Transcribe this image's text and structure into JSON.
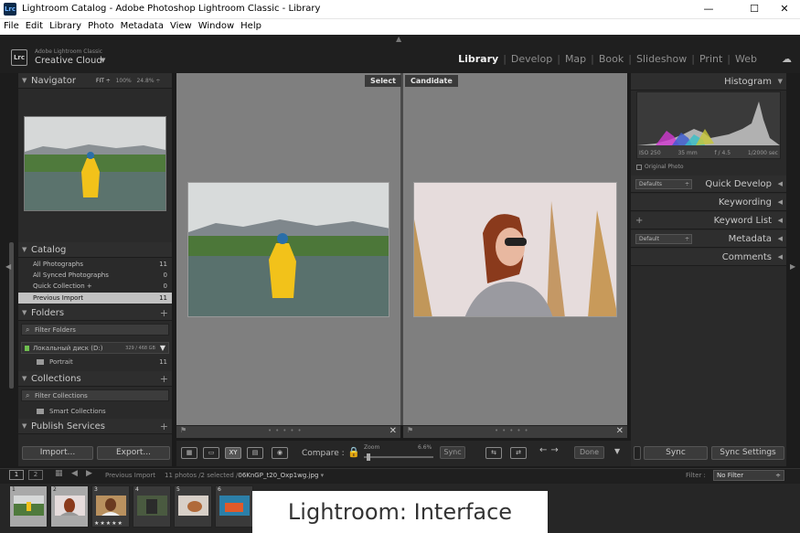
{
  "window": {
    "title": "Lightroom Catalog - Adobe Photoshop Lightroom Classic - Library",
    "app_badge": "Lrc",
    "minimize": "—",
    "maximize": "☐",
    "close": "✕"
  },
  "menu": [
    "File",
    "Edit",
    "Library",
    "Photo",
    "Metadata",
    "View",
    "Window",
    "Help"
  ],
  "identity": {
    "logo": "Lrc",
    "line1": "Adobe Lightroom Classic",
    "line2": "Creative Cloud"
  },
  "modules": [
    "Library",
    "Develop",
    "Map",
    "Book",
    "Slideshow",
    "Print",
    "Web"
  ],
  "active_module": "Library",
  "left_panel": {
    "navigator": {
      "title": "Navigator",
      "fit": "FIT ÷",
      "zoom1": "100%",
      "zoom2": "24.8% ÷"
    },
    "catalog": {
      "title": "Catalog",
      "items": [
        {
          "label": "All Photographs",
          "count": "11"
        },
        {
          "label": "All Synced Photographs",
          "count": "0"
        },
        {
          "label": "Quick Collection +",
          "count": "0"
        },
        {
          "label": "Previous Import",
          "count": "11"
        }
      ]
    },
    "folders": {
      "title": "Folders",
      "filter": "Filter Folders",
      "volume": "Локальный диск (D:)",
      "volume_size": "329 / 468 GB",
      "folder": {
        "label": "Portrait",
        "count": "11"
      }
    },
    "collections": {
      "title": "Collections",
      "filter": "Filter Collections",
      "smart": "Smart Collections"
    },
    "publish": {
      "title": "Publish Services"
    },
    "import_label": "Import...",
    "export_label": "Export..."
  },
  "center": {
    "select_tag": "Select",
    "candidate_tag": "Candidate"
  },
  "right_panel": {
    "histogram": {
      "title": "Histogram",
      "iso": "ISO 250",
      "focal": "35 mm",
      "aperture": "f / 4.5",
      "shutter": "1/2000 sec",
      "original": "Original Photo"
    },
    "quick_develop": {
      "title": "Quick Develop",
      "preset": "Defaults"
    },
    "keywording": {
      "title": "Keywording"
    },
    "keyword_list": {
      "title": "Keyword List"
    },
    "metadata": {
      "title": "Metadata",
      "preset": "Default"
    },
    "comments": {
      "title": "Comments"
    },
    "sync_label": "Sync",
    "sync_settings_label": "Sync Settings"
  },
  "toolbar": {
    "compare": "Compare :",
    "zoom_label": "Zoom",
    "zoom_value": "6.6%",
    "sync": "Sync",
    "done": "Done",
    "xy": "XY"
  },
  "filmstrip_header": {
    "page1": "1",
    "page2": "2",
    "source": "Previous Import",
    "status": "11 photos /2 selected /",
    "file": "06KnGP_t20_Oxp1wg.jpg",
    "filter_label": "Filter :",
    "filter_value": "No Filter"
  },
  "filmstrip": {
    "cells": [
      "1",
      "2",
      "3",
      "4",
      "5",
      "6"
    ],
    "stars": "★★★★★"
  },
  "caption": "Lightroom: Interface",
  "colors": {
    "accent_lock": "#d9a800",
    "panel": "#2a2a2a",
    "center_bg": "#7f7f7f"
  }
}
